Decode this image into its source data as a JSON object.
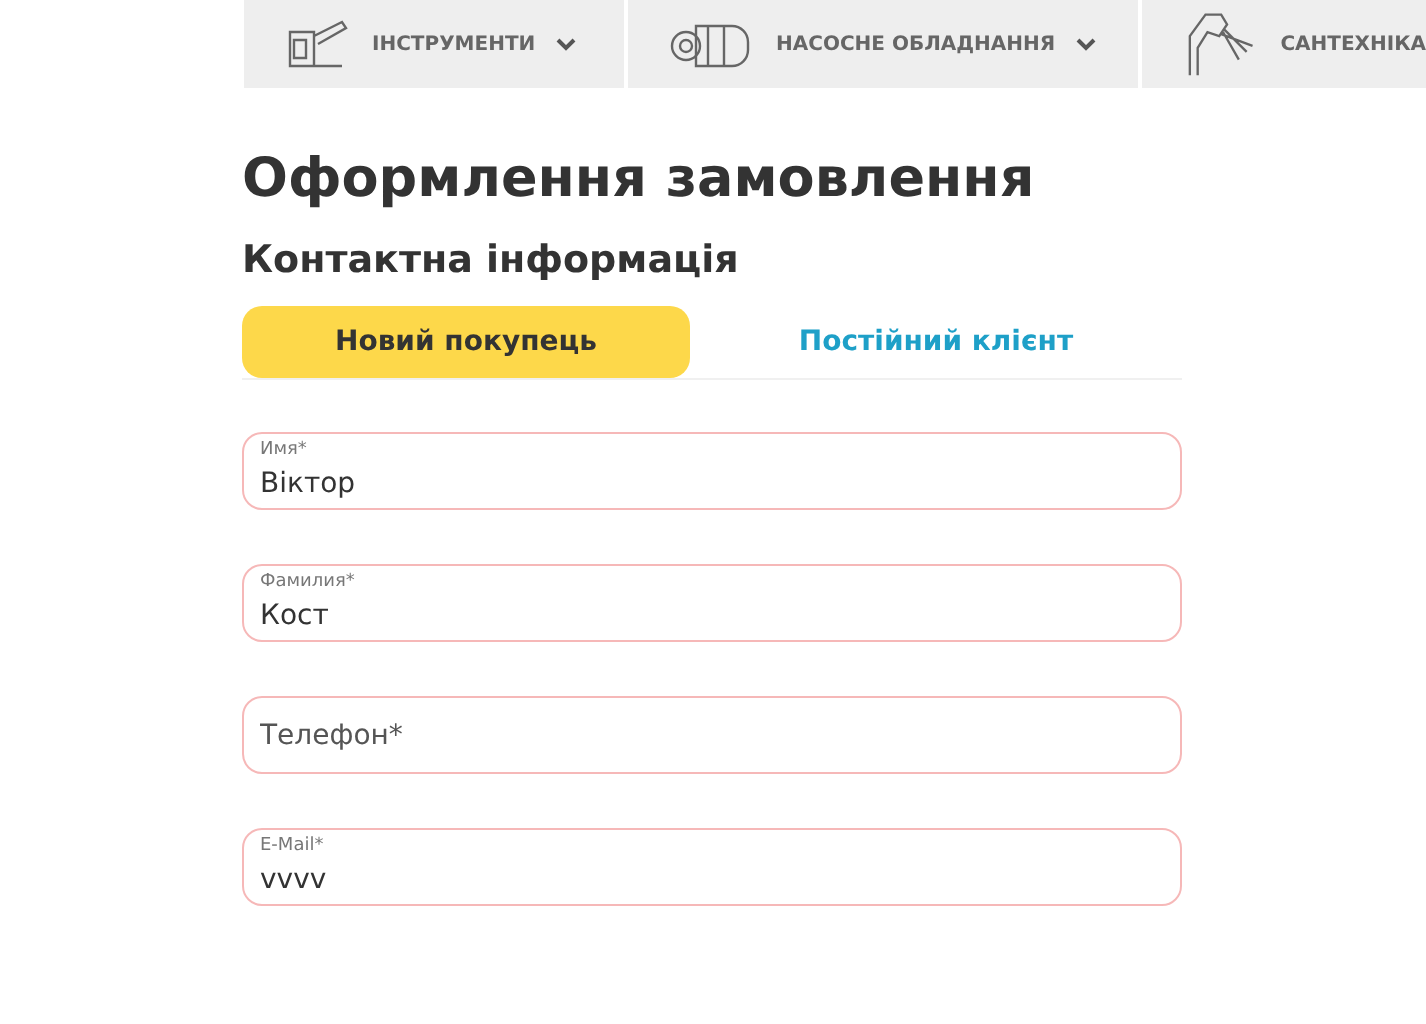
{
  "nav": [
    {
      "label": "ІНСТРУМЕНТИ",
      "has_menu": true
    },
    {
      "label": "НАСОСНЕ ОБЛАДНАННЯ",
      "has_menu": true
    },
    {
      "label": "САНТЕХНІКА",
      "has_menu": false
    }
  ],
  "title": "Оформлення замовлення",
  "section": "Контактна інформація",
  "tabs": [
    {
      "label": "Новий покупець",
      "selected": true
    },
    {
      "label": "Постійний клієнт",
      "selected": false
    }
  ],
  "fields": [
    {
      "label": "Имя*",
      "value": "Віктор"
    },
    {
      "label": "Фамилия*",
      "value": "Кост"
    },
    {
      "placeholder": "Телефон*"
    },
    {
      "label": "E-Mail*",
      "value": "vvvv"
    }
  ]
}
